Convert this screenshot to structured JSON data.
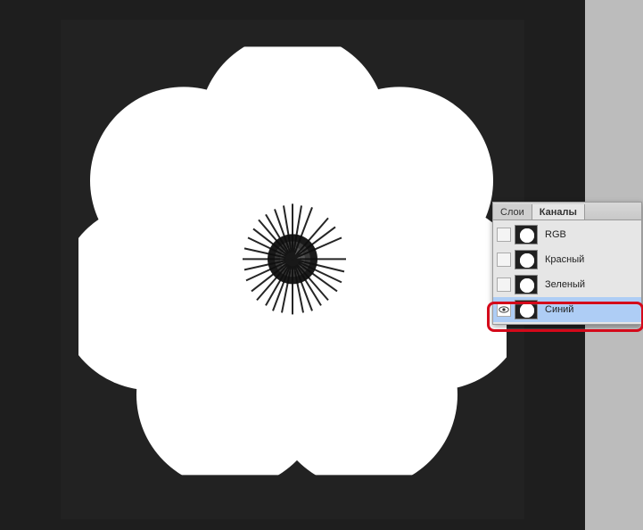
{
  "tabs": {
    "layers": "Слои",
    "channels": "Каналы"
  },
  "channels": {
    "rgb": "RGB",
    "red": "Красный",
    "green": "Зеленый",
    "blue": "Синий"
  }
}
